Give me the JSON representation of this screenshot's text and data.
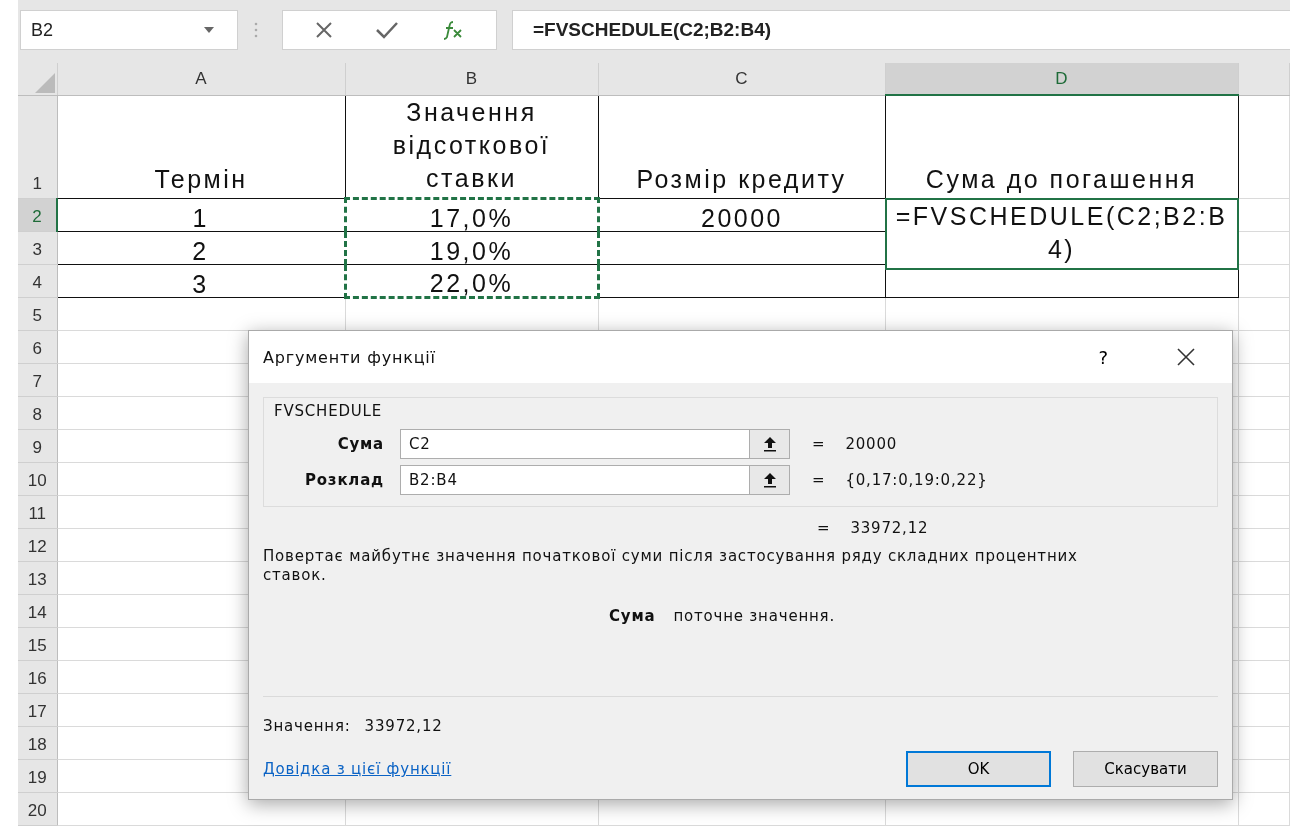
{
  "formula_bar": {
    "name_box": "B2",
    "formula": "=FVSCHEDULE(C2;B2:B4)"
  },
  "columns": [
    {
      "label": "A",
      "selected": false
    },
    {
      "label": "B",
      "selected": false
    },
    {
      "label": "C",
      "selected": false
    },
    {
      "label": "D",
      "selected": true
    }
  ],
  "rows": [
    {
      "number": "1",
      "selected": false,
      "bordered": true,
      "cells": [
        {
          "text": "Термін"
        },
        {
          "text": "Значення відсоткової ставки"
        },
        {
          "text": "Розмір кредиту"
        },
        {
          "text": "Сума до погашення"
        }
      ]
    },
    {
      "number": "2",
      "selected": true,
      "bordered": true,
      "cells": [
        {
          "text": "1"
        },
        {
          "text": "17,0%",
          "marquee": true
        },
        {
          "text": "20000"
        },
        {
          "text": "=FVSCHEDULE(C2;B2:B4)",
          "active": true
        }
      ]
    },
    {
      "number": "3",
      "selected": false,
      "bordered": true,
      "cells": [
        {
          "text": "2"
        },
        {
          "text": "19,0%",
          "marquee": true
        },
        {},
        {}
      ]
    },
    {
      "number": "4",
      "selected": false,
      "bordered": true,
      "cells": [
        {
          "text": "3"
        },
        {
          "text": "22,0%",
          "marquee": true
        },
        {},
        {}
      ]
    },
    {
      "number": "5",
      "selected": false,
      "bordered": false
    },
    {
      "number": "6",
      "selected": false,
      "bordered": false
    },
    {
      "number": "7",
      "selected": false,
      "bordered": false
    },
    {
      "number": "8",
      "selected": false,
      "bordered": false
    },
    {
      "number": "9",
      "selected": false,
      "bordered": false
    },
    {
      "number": "10",
      "selected": false,
      "bordered": false
    },
    {
      "number": "11",
      "selected": false,
      "bordered": false
    },
    {
      "number": "12",
      "selected": false,
      "bordered": false
    },
    {
      "number": "13",
      "selected": false,
      "bordered": false
    },
    {
      "number": "14",
      "selected": false,
      "bordered": false
    },
    {
      "number": "15",
      "selected": false,
      "bordered": false
    },
    {
      "number": "16",
      "selected": false,
      "bordered": false
    },
    {
      "number": "17",
      "selected": false,
      "bordered": false
    },
    {
      "number": "18",
      "selected": false,
      "bordered": false
    },
    {
      "number": "19",
      "selected": false,
      "bordered": false
    },
    {
      "number": "20",
      "selected": false,
      "bordered": false
    }
  ],
  "dialog": {
    "title": "Аргументи функції",
    "help": "?",
    "function_name": "FVSCHEDULE",
    "arguments": [
      {
        "label": "Сума",
        "value": "C2",
        "equals": "=",
        "result": "20000"
      },
      {
        "label": "Розклад",
        "value": "B2:B4",
        "equals": "=",
        "result": "{0,17:0,19:0,22}"
      }
    ],
    "formula_result": {
      "equals": "=",
      "value": "33972,12"
    },
    "description": "Повертає майбутнє значення початкової суми після застосування ряду складних процентних ставок.",
    "argument_help": {
      "name": "Сума",
      "text": "поточне значення."
    },
    "value_label": "Значення:",
    "value": "33972,12",
    "help_link": "Довідка з цієї функції",
    "buttons": [
      {
        "label": "OK",
        "default": true
      },
      {
        "label": "Скасувати",
        "default": false
      }
    ]
  }
}
